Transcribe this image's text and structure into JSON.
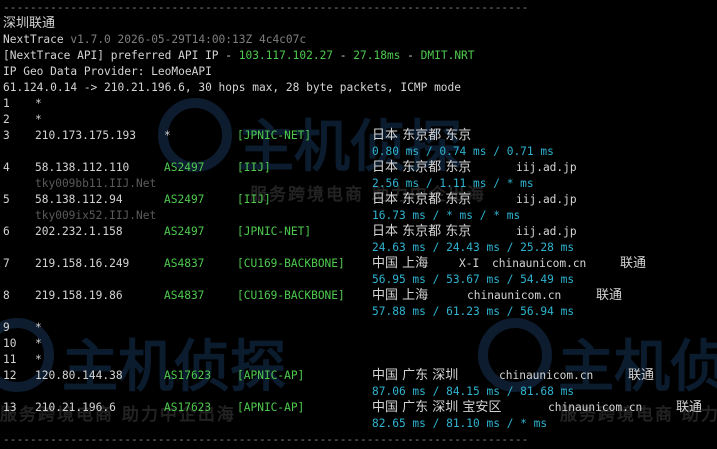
{
  "header": {
    "divider": "------------------------------------------------------------------------------",
    "title": "深圳联通",
    "app_name": "NextTrace",
    "app_version": "v1.7.0 2026-05-29T14:00:13Z 4c4c07c",
    "api_prefix": "[NextTrace API] preferred API IP - ",
    "api_ip": "103.117.102.27",
    "api_sep": " - ",
    "api_latency": "27.18ms",
    "api_sep2": " - ",
    "api_node": "DMIT.NRT",
    "geo_provider": "IP Geo Data Provider: LeoMoeAPI",
    "trace_summary": "61.124.0.14 -> 210.21.196.6, 30 hops max, 28 byte packets, ICMP mode"
  },
  "hops": [
    {
      "num": "1",
      "ip": "*"
    },
    {
      "num": "2",
      "ip": "*"
    },
    {
      "num": "3",
      "ip": "210.173.175.193",
      "asn": "*",
      "net": "[JPNIC-NET]",
      "geo": "日本 东京都 东京",
      "domain": "",
      "isp": "",
      "host": "",
      "rtt": "0.80 ms / 0.74 ms / 0.71 ms"
    },
    {
      "num": "4",
      "ip": "58.138.112.110",
      "asn": "AS2497",
      "net": "[IIJ]",
      "geo": "日本 东京都 东京",
      "domain": "iij.ad.jp",
      "isp": "",
      "host": "tky009bb11.IIJ.Net",
      "rtt": "2.56 ms / 1.11 ms / * ms"
    },
    {
      "num": "5",
      "ip": "58.138.112.94",
      "asn": "AS2497",
      "net": "[IIJ]",
      "geo": "日本 东京都 东京",
      "domain": "iij.ad.jp",
      "isp": "",
      "host": "tky009ix52.IIJ.Net",
      "rtt": "16.73 ms / * ms / * ms"
    },
    {
      "num": "6",
      "ip": "202.232.1.158",
      "asn": "AS2497",
      "net": "[JPNIC-NET]",
      "geo": "日本 东京都 东京",
      "domain": "iij.ad.jp",
      "isp": "",
      "host": "",
      "rtt": "24.63 ms / 24.43 ms / 25.28 ms"
    },
    {
      "num": "7",
      "ip": "219.158.16.249",
      "asn": "AS4837",
      "net": "[CU169-BACKBONE]",
      "geo": "中国 上海",
      "geo_extra": "X-I",
      "domain": "chinaunicom.cn",
      "isp": "联通",
      "host": "",
      "rtt": "56.95 ms / 53.67 ms / 54.49 ms"
    },
    {
      "num": "8",
      "ip": "219.158.19.86",
      "asn": "AS4837",
      "net": "[CU169-BACKBONE]",
      "geo": "中国 上海",
      "geo_extra": "",
      "domain": "chinaunicom.cn",
      "isp": "联通",
      "host": "",
      "rtt": "57.88 ms / 61.23 ms / 56.94 ms"
    },
    {
      "num": "9",
      "ip": "*"
    },
    {
      "num": "10",
      "ip": "*"
    },
    {
      "num": "11",
      "ip": "*"
    },
    {
      "num": "12",
      "ip": "120.80.144.38",
      "asn": "AS17623",
      "net": "[APNIC-AP]",
      "geo": "中国 广东 深圳",
      "geo_extra": "",
      "domain": "chinaunicom.cn",
      "isp": "联通",
      "host": "",
      "rtt": "87.06 ms / 84.15 ms / 81.68 ms"
    },
    {
      "num": "13",
      "ip": "210.21.196.6",
      "asn": "AS17623",
      "net": "[APNIC-AP]",
      "geo": "中国 广东 深圳 宝安区",
      "geo_extra": "",
      "domain": "chinaunicom.cn",
      "isp": "联通",
      "host": "",
      "rtt": "82.65 ms / 81.10 ms / * ms"
    }
  ],
  "watermark": {
    "brand": "主机侦探",
    "slogan": "服务跨境电商 助力中企出海"
  },
  "footer": {
    "divider": "------------------------------------------------------------------------------"
  },
  "colors": {
    "background": "#000000",
    "text": "#d4d4d4",
    "asn": "#4ec94e",
    "rtt": "#2fb3d0",
    "api_ip": "#4ec94e",
    "muted": "#7f7f7f"
  }
}
